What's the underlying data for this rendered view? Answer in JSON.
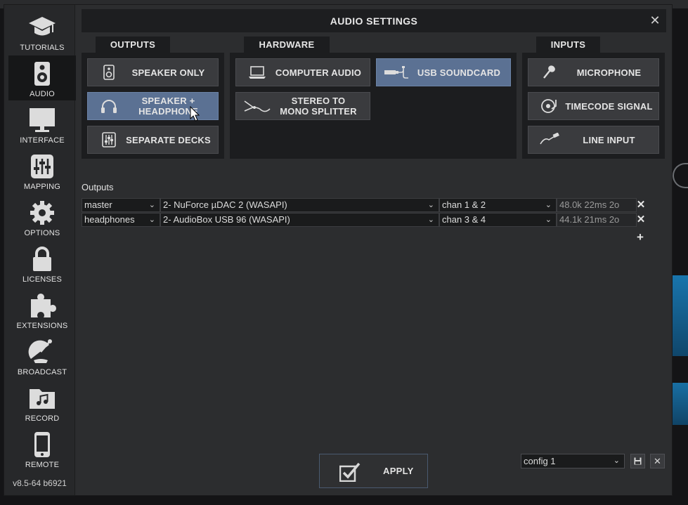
{
  "dialog": {
    "title": "AUDIO SETTINGS",
    "close_icon": "close-icon"
  },
  "sidebar": {
    "items": [
      {
        "label": "TUTORIALS",
        "icon": "graduation-cap-icon"
      },
      {
        "label": "AUDIO",
        "icon": "speaker-icon",
        "active": true
      },
      {
        "label": "INTERFACE",
        "icon": "monitor-icon"
      },
      {
        "label": "MAPPING",
        "icon": "sliders-icon"
      },
      {
        "label": "OPTIONS",
        "icon": "gear-icon"
      },
      {
        "label": "LICENSES",
        "icon": "lock-icon"
      },
      {
        "label": "EXTENSIONS",
        "icon": "puzzle-icon"
      },
      {
        "label": "BROADCAST",
        "icon": "satellite-dish-icon"
      },
      {
        "label": "RECORD",
        "icon": "music-folder-icon"
      },
      {
        "label": "REMOTE",
        "icon": "phone-icon"
      }
    ],
    "version": "v8.5-64 b6921"
  },
  "groups": {
    "outputs": {
      "title": "OUTPUTS",
      "buttons": [
        {
          "label": "SPEAKER ONLY",
          "icon": "speaker-icon",
          "selected": false
        },
        {
          "label": "SPEAKER + HEADPHONE",
          "icon": "headphones-icon",
          "selected": true
        },
        {
          "label": "SEPARATE DECKS",
          "icon": "mixer-icon",
          "selected": false
        }
      ]
    },
    "hardware": {
      "title": "HARDWARE",
      "buttons": [
        {
          "label": "COMPUTER AUDIO",
          "icon": "laptop-icon",
          "selected": false
        },
        {
          "label": "USB SOUNDCARD",
          "icon": "usb-soundcard-icon",
          "selected": true
        },
        {
          "label": "STEREO TO MONO SPLITTER",
          "icon": "splitter-cable-icon",
          "selected": false
        }
      ]
    },
    "inputs": {
      "title": "INPUTS",
      "buttons": [
        {
          "label": "MICROPHONE",
          "icon": "microphone-icon",
          "selected": false
        },
        {
          "label": "TIMECODE SIGNAL",
          "icon": "turntable-icon",
          "selected": false
        },
        {
          "label": "LINE INPUT",
          "icon": "cable-icon",
          "selected": false
        }
      ]
    }
  },
  "outputs_table": {
    "label": "Outputs",
    "rows": [
      {
        "type": "master",
        "device": "2- NuForce µDAC 2 (WASAPI)",
        "channels": "chan 1 & 2",
        "info": "48.0k 22ms 2o"
      },
      {
        "type": "headphones",
        "device": "2- AudioBox USB 96 (WASAPI)",
        "channels": "chan 3 & 4",
        "info": "44.1k 21ms 2o"
      }
    ],
    "delete_icon": "close-icon",
    "add_icon": "plus-icon"
  },
  "footer": {
    "apply_label": "APPLY",
    "config_value": "config 1",
    "save_icon": "floppy-icon",
    "delete_icon": "close-icon"
  },
  "colors": {
    "selected_button": "#5b7193",
    "panel": "#1c1d1f",
    "dialog_bg": "#2c2d2f",
    "accent_wave": "#1a86c7"
  }
}
